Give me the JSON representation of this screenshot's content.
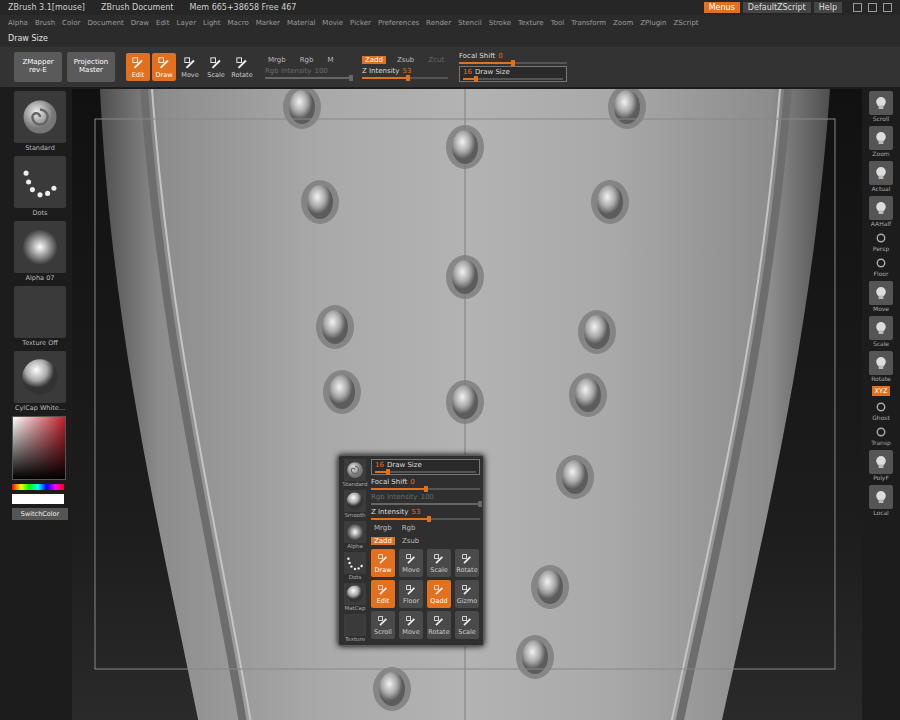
{
  "title_bar": {
    "app": "ZBrush 3.1[mouse]",
    "document": "ZBrush Document",
    "memory": "Mem 665+38658 Free 467",
    "buttons": [
      {
        "label": "Menus",
        "selected": true
      },
      {
        "label": "DefaultZScript",
        "selected": false
      },
      {
        "label": "Help",
        "selected": false
      }
    ]
  },
  "menu_bar": [
    "Alpha",
    "Brush",
    "Color",
    "Document",
    "Draw",
    "Edit",
    "Layer",
    "Light",
    "Macro",
    "Marker",
    "Material",
    "Movie",
    "Picker",
    "Preferences",
    "Render",
    "Stencil",
    "Stroke",
    "Texture",
    "Tool",
    "Transform",
    "Zoom",
    "ZPlugin",
    "ZScript"
  ],
  "status_label": "Draw Size",
  "shelf": {
    "plugins": [
      "ZMapper rev-E",
      "Projection Master"
    ],
    "modes": [
      {
        "label": "Edit",
        "selected": true
      },
      {
        "label": "Draw",
        "selected": true
      },
      {
        "label": "Move",
        "selected": false
      },
      {
        "label": "Scale",
        "selected": false
      },
      {
        "label": "Rotate",
        "selected": false
      }
    ],
    "color_modes": [
      {
        "label": "Mrgb",
        "selected": false,
        "disabled": false
      },
      {
        "label": "Rgb",
        "selected": false,
        "disabled": false
      },
      {
        "label": "M",
        "selected": false,
        "disabled": false
      }
    ],
    "rgb_intensity": {
      "label": "Rgb Intensity",
      "value": "100",
      "level": 1,
      "disabled": true
    },
    "z_modes": [
      {
        "label": "Zadd",
        "selected": true,
        "disabled": false
      },
      {
        "label": "Zsub",
        "selected": false,
        "disabled": false
      },
      {
        "label": "Zcut",
        "selected": false,
        "disabled": true
      }
    ],
    "z_intensity": {
      "label": "Z Intensity",
      "value": "53",
      "level": 0.53,
      "disabled": false
    },
    "focal_shift": {
      "label": "Focal Shift",
      "value": "0",
      "level": 0.5,
      "disabled": false
    },
    "draw_size": {
      "label": "Draw Size",
      "value": "16",
      "level": 0.13,
      "disabled": false
    }
  },
  "left_tray": [
    {
      "label": "Standard",
      "kind": "brush"
    },
    {
      "label": "Dots",
      "kind": "stroke"
    },
    {
      "label": "Alpha 07",
      "kind": "alpha"
    },
    {
      "label": "Texture Off",
      "kind": "texture"
    },
    {
      "label": "CylCap White...",
      "kind": "material"
    }
  ],
  "switch_color": "SwitchColor",
  "right_shelf": [
    {
      "label": "Scroll",
      "kind": "tool",
      "selected": false
    },
    {
      "label": "Zoom",
      "kind": "tool",
      "selected": false
    },
    {
      "label": "Actual",
      "kind": "tool",
      "selected": false
    },
    {
      "label": "AAHalf",
      "kind": "tool",
      "selected": false
    },
    {
      "label": "Persp",
      "kind": "small",
      "selected": false
    },
    {
      "label": "Floor",
      "kind": "small",
      "selected": false
    },
    {
      "label": "Move",
      "kind": "tool",
      "selected": false
    },
    {
      "label": "Scale",
      "kind": "tool",
      "selected": false
    },
    {
      "label": "Rotate",
      "kind": "tool",
      "selected": false
    },
    {
      "label": "XYZ",
      "kind": "toggle",
      "selected": true
    },
    {
      "label": "Ghost",
      "kind": "small",
      "selected": false
    },
    {
      "label": "Transp",
      "kind": "small",
      "selected": false
    },
    {
      "label": "PolyF",
      "kind": "tool",
      "selected": false
    },
    {
      "label": "Local",
      "kind": "tool",
      "selected": false
    }
  ],
  "popup": {
    "palette": [
      {
        "label": "Standard",
        "kind": "brush"
      },
      {
        "label": "Smooth",
        "kind": "material"
      },
      {
        "label": "Alpha",
        "kind": "alpha"
      },
      {
        "label": "Dots",
        "kind": "stroke"
      },
      {
        "label": "MatCap",
        "kind": "material"
      },
      {
        "label": "Texture",
        "kind": "texture"
      }
    ],
    "sliders": [
      {
        "label": "Draw Size",
        "value": "16",
        "level": 0.13,
        "disabled": false
      },
      {
        "label": "Focal Shift",
        "value": "0",
        "level": 0.5,
        "disabled": false
      },
      {
        "label": "Rgb Intensity",
        "value": "100",
        "level": 1,
        "disabled": true
      },
      {
        "label": "Z Intensity",
        "value": "53",
        "level": 0.53,
        "disabled": false
      }
    ],
    "rows": [
      {
        "kind": "text",
        "buttons": [
          {
            "label": "Mrgb",
            "selected": false
          },
          {
            "label": "Rgb",
            "selected": false
          }
        ]
      },
      {
        "kind": "text",
        "buttons": [
          {
            "label": "Zadd",
            "selected": true
          },
          {
            "label": "Zsub",
            "selected": false
          }
        ]
      },
      {
        "kind": "icon",
        "buttons": [
          {
            "label": "Draw",
            "selected": true
          },
          {
            "label": "Move",
            "selected": false
          },
          {
            "label": "Scale",
            "selected": false
          },
          {
            "label": "Rotate",
            "selected": false
          }
        ]
      },
      {
        "kind": "icon",
        "buttons": [
          {
            "label": "Edit",
            "selected": true
          },
          {
            "label": "Floor",
            "selected": false
          },
          {
            "label": "Qadd",
            "selected": true
          },
          {
            "label": "Gizmo",
            "selected": false
          }
        ]
      },
      {
        "kind": "icon",
        "buttons": [
          {
            "label": "Scroll",
            "selected": false
          },
          {
            "label": "Move",
            "selected": false
          },
          {
            "label": "Rotate",
            "selected": false
          },
          {
            "label": "Scale",
            "selected": false
          }
        ]
      }
    ]
  }
}
